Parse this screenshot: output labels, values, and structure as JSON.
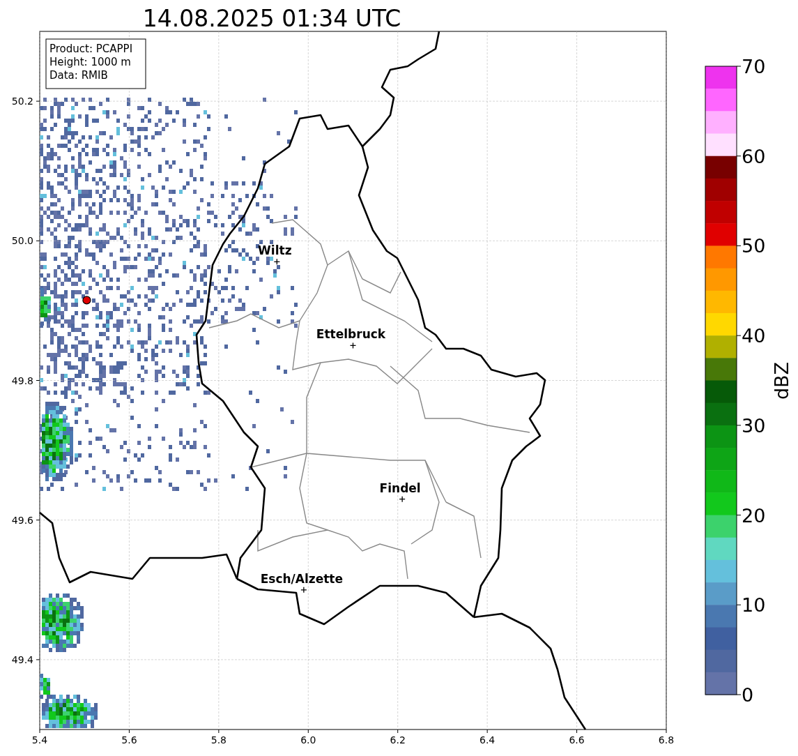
{
  "title": "14.08.2025 01:34 UTC",
  "info_box": [
    "Product: PCAPPI",
    "Height: 1000 m",
    "Data: RMIB"
  ],
  "map": {
    "y_ticks": [
      "50.2",
      "50.0",
      "49.8",
      "49.6",
      "49.4"
    ],
    "x_ticks": [
      "5.4",
      "5.6",
      "5.8",
      "6.0",
      "6.2",
      "6.4",
      "6.6",
      "6.8"
    ],
    "cities": [
      "Wiltz",
      "Ettelbruck",
      "Findel",
      "Esch/Alzette"
    ]
  },
  "colorbar": {
    "label": "dBZ",
    "ticks": [
      "70",
      "60",
      "50",
      "40",
      "30",
      "20",
      "10",
      "0"
    ],
    "segments": [
      {
        "color": "#ee33ee"
      },
      {
        "color": "#ff66ff"
      },
      {
        "color": "#ffb0ff"
      },
      {
        "color": "#ffe0ff"
      },
      {
        "color": "#780000"
      },
      {
        "color": "#a00000"
      },
      {
        "color": "#c00000"
      },
      {
        "color": "#e00000"
      },
      {
        "color": "#ff7800"
      },
      {
        "color": "#ff9800"
      },
      {
        "color": "#ffb800"
      },
      {
        "color": "#ffd800"
      },
      {
        "color": "#b0b000"
      },
      {
        "color": "#487808"
      },
      {
        "color": "#065a08"
      },
      {
        "color": "#0a7010"
      },
      {
        "color": "#0c9414"
      },
      {
        "color": "#0ea516"
      },
      {
        "color": "#10b818"
      },
      {
        "color": "#12c81c"
      },
      {
        "color": "#3cd26c"
      },
      {
        "color": "#60d8c0"
      },
      {
        "color": "#64c0dc"
      },
      {
        "color": "#5a9cc8"
      },
      {
        "color": "#4a78b0"
      },
      {
        "color": "#4060a0"
      },
      {
        "color": "#5068a0"
      },
      {
        "color": "#6473a8"
      }
    ]
  }
}
